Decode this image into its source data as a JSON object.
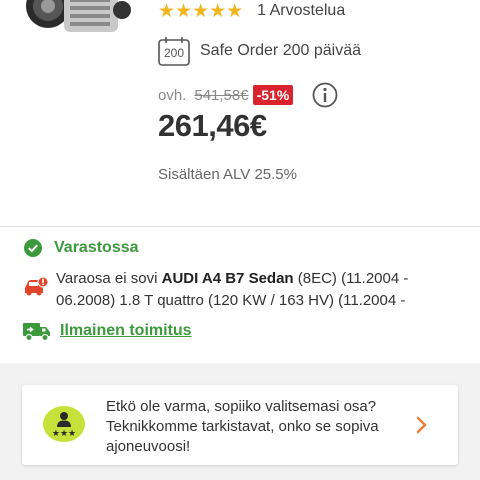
{
  "product": {
    "image_icon": "alternator-image",
    "stars_display": "★★★★★",
    "review_count": "1 Arvostelua",
    "safe_order_icon_text": "200",
    "safe_order_label": "Safe Order 200 päivää"
  },
  "pricing": {
    "old_prefix": "ovh.",
    "old_price": "541,58€",
    "discount": "-51%",
    "price": "261,46€",
    "vat_note": "Sisältäen ALV 25.5%"
  },
  "availability": {
    "stock_label": "Varastossa",
    "fit_text_prefix": "Varaosa ei sovi ",
    "fit_vehicle": "AUDI A4 B7 Sedan",
    "fit_text_rest": " (8EC) (11.2004 - 06.2008) 1.8 T quattro (120 KW / 163 HV) (11.2004 -",
    "shipping_label": "Ilmainen toimitus"
  },
  "help_card": {
    "text": "Etkö ole varma, sopiiko valitsemasi osa? Teknikkomme tarkistavat, onko se sopiva ajoneuvoosi!"
  },
  "colors": {
    "star": "#f2b620",
    "discount_bg": "#d9232d",
    "success_green": "#3c9a3c",
    "warning_red": "#e0452b",
    "chevron_orange": "#e8823a",
    "expert_badge": "#c6e13a"
  }
}
